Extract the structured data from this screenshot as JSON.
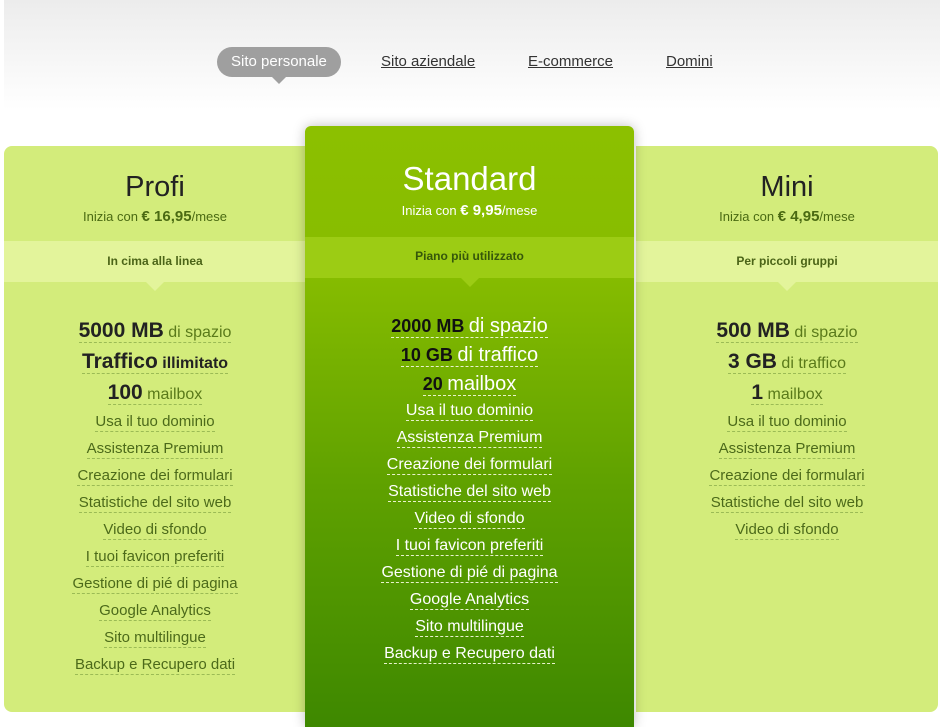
{
  "tabs": [
    {
      "label": "Sito personale",
      "active": true
    },
    {
      "label": "Sito aziendale",
      "active": false
    },
    {
      "label": "E-commerce",
      "active": false
    },
    {
      "label": "Domini",
      "active": false
    }
  ],
  "colors": {
    "side_card": "#d3ec7b",
    "side_band": "#e3f49b",
    "featured_top": "#8cc000",
    "featured_bottom": "#3e8800",
    "active_tab": "#9f9f9f"
  },
  "plans": {
    "profi": {
      "name": "Profi",
      "price_prefix": "Inizia con",
      "price_amount": "€ 16,95",
      "price_suffix": "/mese",
      "band": "In cima alla linea",
      "highlights": [
        {
          "value": "5000 MB",
          "unit": "di spazio"
        },
        {
          "value": "Traffico",
          "unit": "illimitato"
        },
        {
          "value": "100",
          "unit": "mailbox"
        }
      ],
      "features": [
        "Usa il tuo dominio",
        "Assistenza Premium",
        "Creazione dei formulari",
        "Statistiche del sito web",
        "Video di sfondo",
        "I tuoi favicon preferiti",
        "Gestione di pié di pagina",
        "Google Analytics",
        "Sito multilingue",
        "Backup e Recupero dati"
      ]
    },
    "standard": {
      "name": "Standard",
      "price_prefix": "Inizia con",
      "price_amount": "€ 9,95",
      "price_suffix": "/mese",
      "band": "Piano più utilizzato",
      "highlights": [
        {
          "value": "2000 MB",
          "unit": "di spazio"
        },
        {
          "value": "10 GB",
          "unit": "di traffico"
        },
        {
          "value": "20",
          "unit": "mailbox"
        }
      ],
      "features": [
        "Usa il tuo dominio",
        "Assistenza Premium",
        "Creazione dei formulari",
        "Statistiche del sito web",
        "Video di sfondo",
        "I tuoi favicon preferiti",
        "Gestione di pié di pagina",
        "Google Analytics",
        "Sito multilingue",
        "Backup e Recupero dati"
      ]
    },
    "mini": {
      "name": "Mini",
      "price_prefix": "Inizia con",
      "price_amount": "€ 4,95",
      "price_suffix": "/mese",
      "band": "Per piccoli gruppi",
      "highlights": [
        {
          "value": "500 MB",
          "unit": "di spazio"
        },
        {
          "value": "3 GB",
          "unit": "di traffico"
        },
        {
          "value": "1",
          "unit": "mailbox"
        }
      ],
      "features": [
        "Usa il tuo dominio",
        "Assistenza Premium",
        "Creazione dei formulari",
        "Statistiche del sito web",
        "Video di sfondo"
      ]
    }
  }
}
